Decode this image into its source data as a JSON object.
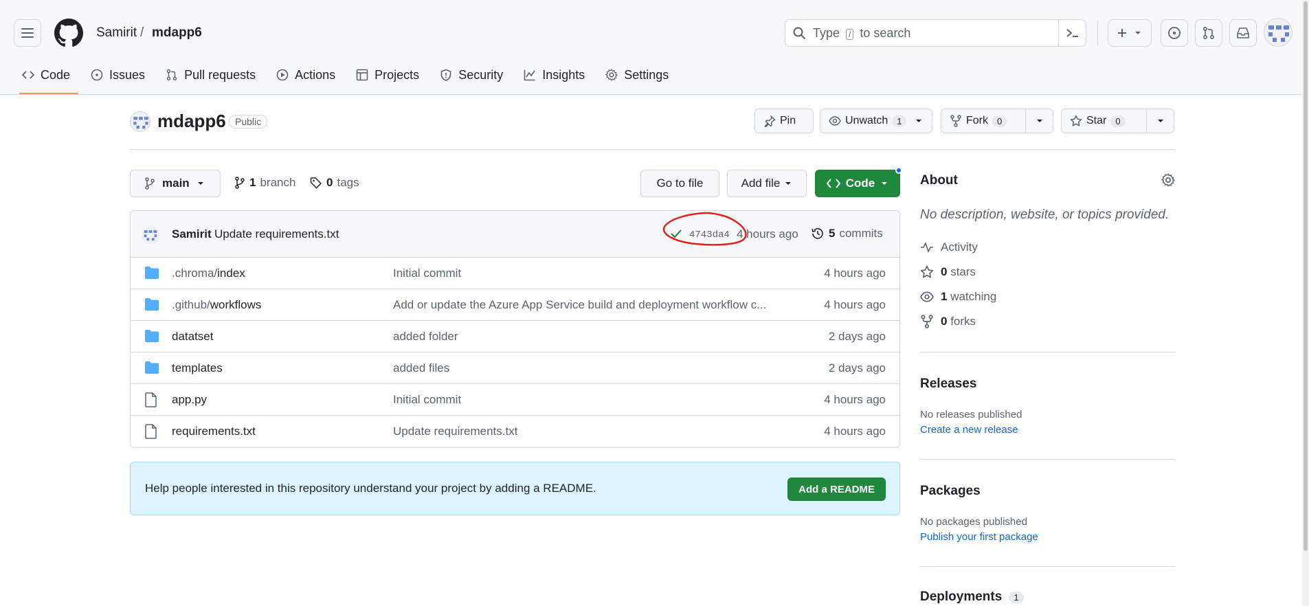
{
  "header": {
    "owner": "Samirit",
    "separator": "/",
    "repo": "mdapp6",
    "search_prefix": "Type",
    "search_key": "/",
    "search_suffix": "to search"
  },
  "nav": {
    "tabs": [
      {
        "label": "Code",
        "icon": "code-icon"
      },
      {
        "label": "Issues",
        "icon": "issue-opened-icon"
      },
      {
        "label": "Pull requests",
        "icon": "git-pull-request-icon"
      },
      {
        "label": "Actions",
        "icon": "play-icon"
      },
      {
        "label": "Projects",
        "icon": "table-icon"
      },
      {
        "label": "Security",
        "icon": "shield-icon"
      },
      {
        "label": "Insights",
        "icon": "graph-icon"
      },
      {
        "label": "Settings",
        "icon": "gear-icon"
      }
    ]
  },
  "repo": {
    "name": "mdapp6",
    "visibility": "Public",
    "pin_label": "Pin",
    "watch_label": "Unwatch",
    "watch_count": "1",
    "fork_label": "Fork",
    "fork_count": "0",
    "star_label": "Star",
    "star_count": "0"
  },
  "toolbar": {
    "branch": "main",
    "branch_count": "1",
    "branch_label": "branch",
    "tag_count": "0",
    "tag_label": "tags",
    "goto_file": "Go to file",
    "add_file": "Add file",
    "code": "Code"
  },
  "latest_commit": {
    "author": "Samirit",
    "message": "Update requirements.txt",
    "sha": "4743da4",
    "age": "4 hours ago",
    "commit_count": "5",
    "commit_label": "commits"
  },
  "files": [
    {
      "type": "dir",
      "prefix": ".chroma/",
      "name": "index",
      "message": "Initial commit",
      "age": "4 hours ago"
    },
    {
      "type": "dir",
      "prefix": ".github/",
      "name": "workflows",
      "message": "Add or update the Azure App Service build and deployment workflow c...",
      "age": "4 hours ago"
    },
    {
      "type": "dir",
      "prefix": "",
      "name": "datatset",
      "message": "added folder",
      "age": "2 days ago"
    },
    {
      "type": "dir",
      "prefix": "",
      "name": "templates",
      "message": "added files",
      "age": "2 days ago"
    },
    {
      "type": "file",
      "prefix": "",
      "name": "app.py",
      "message": "Initial commit",
      "age": "4 hours ago"
    },
    {
      "type": "file",
      "prefix": "",
      "name": "requirements.txt",
      "message": "Update requirements.txt",
      "age": "4 hours ago"
    }
  ],
  "readme": {
    "text": "Help people interested in this repository understand your project by adding a README.",
    "button": "Add a README"
  },
  "about": {
    "title": "About",
    "description": "No description, website, or topics provided.",
    "activity": "Activity",
    "stars_count": "0",
    "stars_label": "stars",
    "watching_count": "1",
    "watching_label": "watching",
    "forks_count": "0",
    "forks_label": "forks"
  },
  "releases": {
    "title": "Releases",
    "empty": "No releases published",
    "link": "Create a new release"
  },
  "packages": {
    "title": "Packages",
    "empty": "No packages published",
    "link": "Publish your first package"
  },
  "deployments": {
    "title": "Deployments",
    "count": "1"
  },
  "colors": {
    "accent_green": "#1f883d",
    "link_blue": "#0969da",
    "tab_underline": "#fd8c73",
    "annotation_red": "#e0201b"
  }
}
